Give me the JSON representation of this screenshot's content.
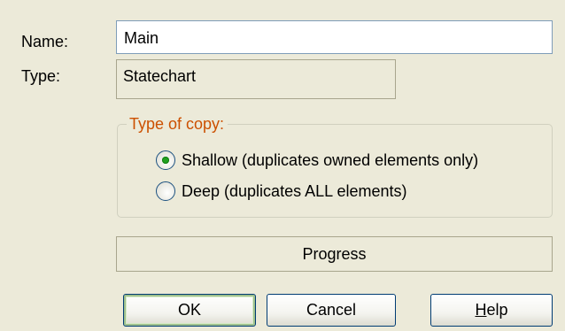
{
  "form": {
    "name_label": "Name:",
    "name_value": "Main",
    "type_label": "Type:",
    "type_value": "Statechart"
  },
  "copy_type": {
    "title": "Type of copy:",
    "selected": "shallow",
    "options": [
      {
        "id": "shallow",
        "label": "Shallow (duplicates owned elements only)",
        "checked": true
      },
      {
        "id": "deep",
        "label": "Deep (duplicates ALL elements)",
        "checked": false
      }
    ]
  },
  "progress": {
    "label": "Progress"
  },
  "buttons": {
    "ok": "OK",
    "cancel": "Cancel",
    "help_mnemonic": "H",
    "help_rest": "elp"
  },
  "colors": {
    "background": "#ecead9",
    "group_title": "#cc5000",
    "radio_dot": "#21a121",
    "button_border": "#003c74"
  },
  "icons": {
    "radio_selected": "radio-selected-icon",
    "radio_unselected": "radio-unselected-icon"
  }
}
